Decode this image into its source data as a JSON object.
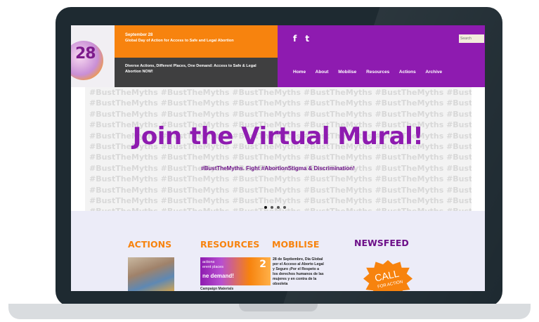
{
  "brand": {
    "logo_number": "28",
    "colors": {
      "orange": "#f7830e",
      "purple": "#8e1bb0",
      "dark": "#3f3f40",
      "lavender": "#ececf8"
    }
  },
  "header": {
    "date_line": "September 28",
    "tagline": "Global Day of Action for Access to Safe and Legal Abortion",
    "slogan": "Diverse Actions, Different Places, One Demand: Access to Safe & Legal Abortion NOW!",
    "social": {
      "facebook": "f",
      "twitter": "t",
      "facebook_icon": "facebook-icon",
      "twitter_icon": "twitter-icon"
    },
    "search": {
      "placeholder": "Search"
    }
  },
  "nav": {
    "items": [
      {
        "label": "Home"
      },
      {
        "label": "About"
      },
      {
        "label": "Mobilise"
      },
      {
        "label": "Resources"
      },
      {
        "label": "Actions"
      },
      {
        "label": "Archive"
      }
    ]
  },
  "banner": {
    "background_text": "#BustTheMyths",
    "headline": "Join the Virtual Mural!",
    "subline": "#BustTheMyths. Fight #AbortionStigma & Discrimination!",
    "slides": 4,
    "active_slide": 1
  },
  "sections": {
    "actions": {
      "title": "ACTIONS"
    },
    "resources": {
      "title": "RESOURCES",
      "thumb_text_1": "actions",
      "thumb_text_2": "erent places",
      "thumb_text_3": "ne demand!",
      "thumb_num": "2",
      "caption": "Campaign Materials"
    },
    "mobilise": {
      "title": "MOBILISE",
      "text": "28 de Septiembre, Día Global por el Acceso al Aborto Legal y Seguro ¡Por el Respeto a los derechos humanos de las mujeres y en contra de la obsoleta"
    },
    "newsfeed": {
      "title": "NEWSFEED",
      "badge_line1": "CALL",
      "badge_line2": "FOR ACTION"
    }
  }
}
